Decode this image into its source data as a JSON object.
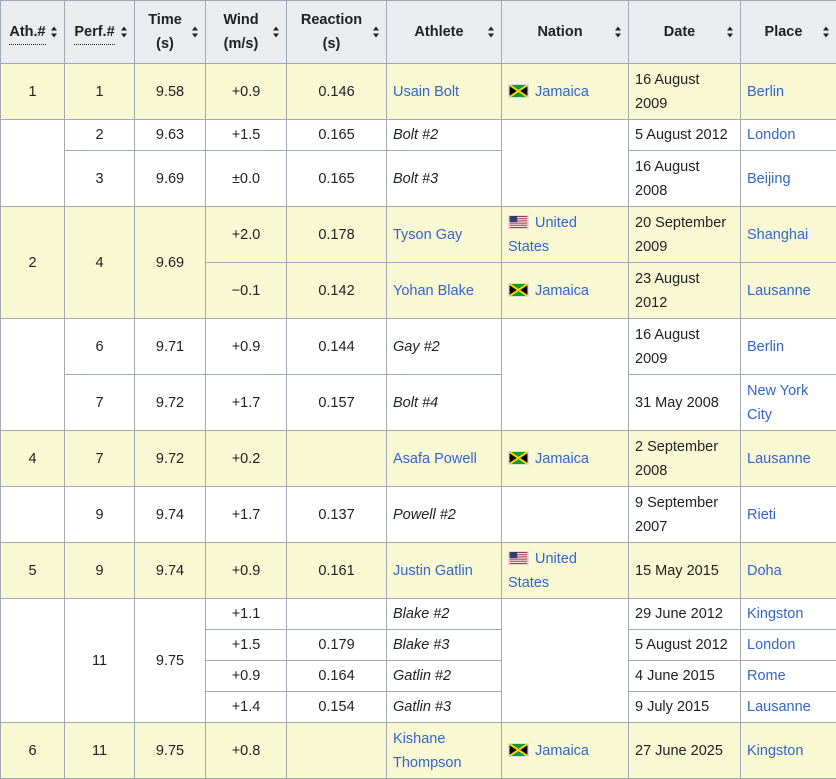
{
  "headers": {
    "ath": "Ath.#",
    "perf": "Perf.#",
    "time_1": "Time",
    "time_2": "(s)",
    "wind_1": "Wind",
    "wind_2": "(m/s)",
    "reaction_1": "Reaction",
    "reaction_2": "(s)",
    "athlete": "Athlete",
    "nation": "Nation",
    "date": "Date",
    "place": "Place"
  },
  "rows": [
    {
      "ath": "1",
      "perf": "1",
      "time": "9.58",
      "wind": "+0.9",
      "reaction": "0.146",
      "athlete": "Usain Bolt",
      "nation": "Jamaica",
      "date": "16 August 2009",
      "place": "Berlin"
    },
    {
      "perf": "2",
      "time": "9.63",
      "wind": "+1.5",
      "reaction": "0.165",
      "athlete": "Bolt #2",
      "date": "5 August 2012",
      "place": "London"
    },
    {
      "perf": "3",
      "time": "9.69",
      "wind": "±0.0",
      "reaction": "0.165",
      "athlete": "Bolt #3",
      "date": "16 August 2008",
      "place": "Beijing"
    },
    {
      "ath": "2",
      "perf": "4",
      "time": "9.69",
      "wind": "+2.0",
      "reaction": "0.178",
      "athlete": "Tyson Gay",
      "nation": "United States",
      "date": "20 September 2009",
      "place": "Shanghai"
    },
    {
      "wind": "−0.1",
      "reaction": "0.142",
      "athlete": "Yohan Blake",
      "nation": "Jamaica",
      "date": "23 August 2012",
      "place": "Lausanne"
    },
    {
      "perf": "6",
      "time": "9.71",
      "wind": "+0.9",
      "reaction": "0.144",
      "athlete": "Gay #2",
      "date": "16 August 2009",
      "place": "Berlin"
    },
    {
      "perf": "7",
      "time": "9.72",
      "wind": "+1.7",
      "reaction": "0.157",
      "athlete": "Bolt #4",
      "date": "31 May 2008",
      "place": "New York City"
    },
    {
      "ath": "4",
      "perf": "7",
      "time": "9.72",
      "wind": "+0.2",
      "reaction": "",
      "athlete": "Asafa Powell",
      "nation": "Jamaica",
      "date": "2 September 2008",
      "place": "Lausanne"
    },
    {
      "perf": "9",
      "time": "9.74",
      "wind": "+1.7",
      "reaction": "0.137",
      "athlete": "Powell #2",
      "date": "9 September 2007",
      "place": "Rieti"
    },
    {
      "ath": "5",
      "perf": "9",
      "time": "9.74",
      "wind": "+0.9",
      "reaction": "0.161",
      "athlete": "Justin Gatlin",
      "nation": "United States",
      "date": "15 May 2015",
      "place": "Doha"
    },
    {
      "perf": "11",
      "time": "9.75",
      "wind": "+1.1",
      "reaction": "",
      "athlete": "Blake #2",
      "date": "29 June 2012",
      "place": "Kingston"
    },
    {
      "wind": "+1.5",
      "reaction": "0.179",
      "athlete": "Blake #3",
      "date": "5 August 2012",
      "place": "London"
    },
    {
      "wind": "+0.9",
      "reaction": "0.164",
      "athlete": "Gatlin #2",
      "date": "4 June 2015",
      "place": "Rome"
    },
    {
      "wind": "+1.4",
      "reaction": "0.154",
      "athlete": "Gatlin #3",
      "date": "9 July 2015",
      "place": "Lausanne"
    },
    {
      "ath": "6",
      "perf": "11",
      "time": "9.75",
      "wind": "+0.8",
      "reaction": "",
      "athlete": "Kishane Thompson",
      "nation": "Jamaica",
      "date": "27 June 2025",
      "place": "Kingston"
    }
  ],
  "icons": {
    "flag_jamaica": "jamaica-flag-icon",
    "flag_usa": "united-states-flag-icon",
    "sort": "sort-arrows-icon"
  },
  "colors": {
    "header_bg": "#eaecf0",
    "highlight_row": "#f8f8d3",
    "link": "#3366cc",
    "border": "#a2a9b1"
  }
}
